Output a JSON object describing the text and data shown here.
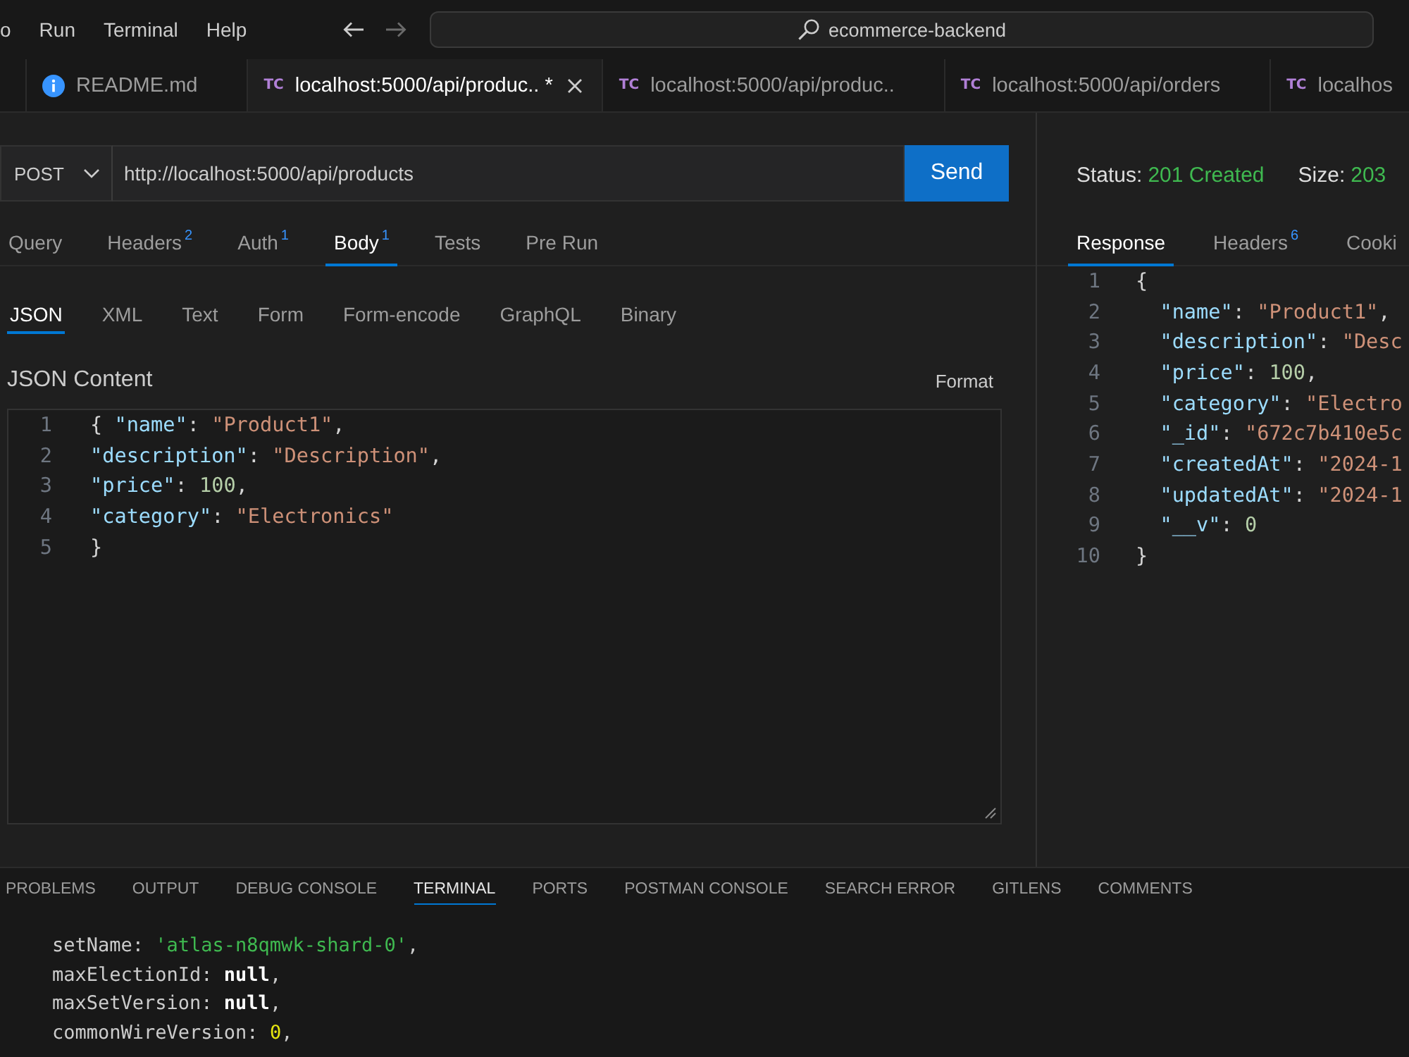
{
  "menu": [
    {
      "label": "o"
    },
    {
      "label": "Run"
    },
    {
      "label": "Terminal"
    },
    {
      "label": "Help"
    }
  ],
  "nav": [
    {
      "kind": "back",
      "disabled": false
    },
    {
      "kind": "forward",
      "disabled": true
    }
  ],
  "search": {
    "label": "ecommerce-backend"
  },
  "editor_tabs": [
    {
      "kind": "info",
      "title": "README.md",
      "selected": false,
      "closable": false
    },
    {
      "kind": "request",
      "badge": "TC",
      "title": "localhost:5000/api/produc.. *",
      "selected": true,
      "closable": true
    },
    {
      "kind": "request",
      "badge": "TC",
      "title": "localhost:5000/api/produc..",
      "selected": false,
      "closable": false
    },
    {
      "kind": "request",
      "badge": "TC",
      "title": "localhost:5000/api/orders",
      "selected": false,
      "closable": false
    },
    {
      "kind": "request",
      "badge": "TC",
      "title": "localhos",
      "selected": false,
      "closable": false
    }
  ],
  "request": {
    "method": "POST",
    "url": "http://localhost:5000/api/products",
    "send": "Send",
    "tabs": [
      {
        "label": "Query",
        "selected": false
      },
      {
        "label": "Headers",
        "count": "2",
        "selected": false
      },
      {
        "label": "Auth",
        "count": "1",
        "selected": false
      },
      {
        "label": "Body",
        "count": "1",
        "selected": true
      },
      {
        "label": "Tests",
        "selected": false
      },
      {
        "label": "Pre Run",
        "selected": false
      }
    ],
    "body_types": [
      {
        "label": "JSON",
        "selected": true
      },
      {
        "label": "XML",
        "selected": false
      },
      {
        "label": "Text",
        "selected": false
      },
      {
        "label": "Form",
        "selected": false
      },
      {
        "label": "Form-encode",
        "selected": false
      },
      {
        "label": "GraphQL",
        "selected": false
      },
      {
        "label": "Binary",
        "selected": false
      }
    ],
    "content_label": "JSON Content",
    "format": "Format",
    "body_lines": [
      {
        "number": "1",
        "tokens": [
          {
            "text": "{ ",
            "kind": "punct"
          },
          {
            "text": "\"name\"",
            "kind": "key"
          },
          {
            "text": ": ",
            "kind": "punct"
          },
          {
            "text": "\"Product1\"",
            "kind": "string"
          },
          {
            "text": ",",
            "kind": "punct"
          }
        ]
      },
      {
        "number": "2",
        "tokens": [
          {
            "text": "\"description\"",
            "kind": "key"
          },
          {
            "text": ": ",
            "kind": "punct"
          },
          {
            "text": "\"Description\"",
            "kind": "string"
          },
          {
            "text": ",",
            "kind": "punct"
          }
        ]
      },
      {
        "number": "3",
        "tokens": [
          {
            "text": "\"price\"",
            "kind": "key"
          },
          {
            "text": ": ",
            "kind": "punct"
          },
          {
            "text": "100",
            "kind": "number"
          },
          {
            "text": ",",
            "kind": "punct"
          }
        ]
      },
      {
        "number": "4",
        "tokens": [
          {
            "text": "\"category\"",
            "kind": "key"
          },
          {
            "text": ": ",
            "kind": "punct"
          },
          {
            "text": "\"Electronics\"",
            "kind": "string"
          }
        ]
      },
      {
        "number": "5",
        "tokens": [
          {
            "text": "}",
            "kind": "punct"
          }
        ]
      }
    ]
  },
  "response": {
    "status_label": "Status:",
    "status": "201 Created",
    "size_label": "Size:",
    "size": "203",
    "tabs": [
      {
        "label": "Response",
        "selected": true
      },
      {
        "label": "Headers",
        "count": "6",
        "selected": false
      },
      {
        "label": "Cooki",
        "selected": false
      }
    ],
    "lines": [
      {
        "number": "1",
        "tokens": [
          {
            "text": "{",
            "kind": "punct"
          }
        ]
      },
      {
        "number": "2",
        "tokens": [
          {
            "text": "  \"name\"",
            "kind": "key"
          },
          {
            "text": ": ",
            "kind": "punct"
          },
          {
            "text": "\"Product1\"",
            "kind": "string"
          },
          {
            "text": ",",
            "kind": "punct"
          }
        ]
      },
      {
        "number": "3",
        "tokens": [
          {
            "text": "  \"description\"",
            "kind": "key"
          },
          {
            "text": ": ",
            "kind": "punct"
          },
          {
            "text": "\"Desc",
            "kind": "string"
          }
        ]
      },
      {
        "number": "4",
        "tokens": [
          {
            "text": "  \"price\"",
            "kind": "key"
          },
          {
            "text": ": ",
            "kind": "punct"
          },
          {
            "text": "100",
            "kind": "number"
          },
          {
            "text": ",",
            "kind": "punct"
          }
        ]
      },
      {
        "number": "5",
        "tokens": [
          {
            "text": "  \"category\"",
            "kind": "key"
          },
          {
            "text": ": ",
            "kind": "punct"
          },
          {
            "text": "\"Electro",
            "kind": "string"
          }
        ]
      },
      {
        "number": "6",
        "tokens": [
          {
            "text": "  \"_id\"",
            "kind": "key"
          },
          {
            "text": ": ",
            "kind": "punct"
          },
          {
            "text": "\"672c7b410e5c",
            "kind": "string"
          }
        ]
      },
      {
        "number": "7",
        "tokens": [
          {
            "text": "  \"createdAt\"",
            "kind": "key"
          },
          {
            "text": ": ",
            "kind": "punct"
          },
          {
            "text": "\"2024-1",
            "kind": "string"
          }
        ]
      },
      {
        "number": "8",
        "tokens": [
          {
            "text": "  \"updatedAt\"",
            "kind": "key"
          },
          {
            "text": ": ",
            "kind": "punct"
          },
          {
            "text": "\"2024-1",
            "kind": "string"
          }
        ]
      },
      {
        "number": "9",
        "tokens": [
          {
            "text": "  \"__v\"",
            "kind": "key"
          },
          {
            "text": ": ",
            "kind": "punct"
          },
          {
            "text": "0",
            "kind": "number"
          }
        ]
      },
      {
        "number": "10",
        "tokens": [
          {
            "text": "}",
            "kind": "punct"
          }
        ]
      }
    ]
  },
  "panel": {
    "tabs": [
      {
        "label": "PROBLEMS",
        "selected": false
      },
      {
        "label": "OUTPUT",
        "selected": false
      },
      {
        "label": "DEBUG CONSOLE",
        "selected": false
      },
      {
        "label": "TERMINAL",
        "selected": true
      },
      {
        "label": "PORTS",
        "selected": false
      },
      {
        "label": "POSTMAN CONSOLE",
        "selected": false
      },
      {
        "label": "SEARCH ERROR",
        "selected": false
      },
      {
        "label": "GITLENS",
        "selected": false
      },
      {
        "label": "COMMENTS",
        "selected": false
      }
    ],
    "terminal_lines": [
      {
        "tokens": [
          {
            "text": "setName: ",
            "kind": "plain"
          },
          {
            "text": "'atlas-n8qmwk-shard-0'",
            "kind": "string"
          },
          {
            "text": ",",
            "kind": "plain"
          }
        ]
      },
      {
        "tokens": [
          {
            "text": "maxElectionId: ",
            "kind": "plain"
          },
          {
            "text": "null",
            "kind": "keyword"
          },
          {
            "text": ",",
            "kind": "plain"
          }
        ]
      },
      {
        "tokens": [
          {
            "text": "maxSetVersion: ",
            "kind": "plain"
          },
          {
            "text": "null",
            "kind": "keyword"
          },
          {
            "text": ",",
            "kind": "plain"
          }
        ]
      },
      {
        "tokens": [
          {
            "text": "commonWireVersion: ",
            "kind": "plain"
          },
          {
            "text": "0",
            "kind": "number"
          },
          {
            "text": ",",
            "kind": "plain"
          }
        ]
      }
    ]
  }
}
